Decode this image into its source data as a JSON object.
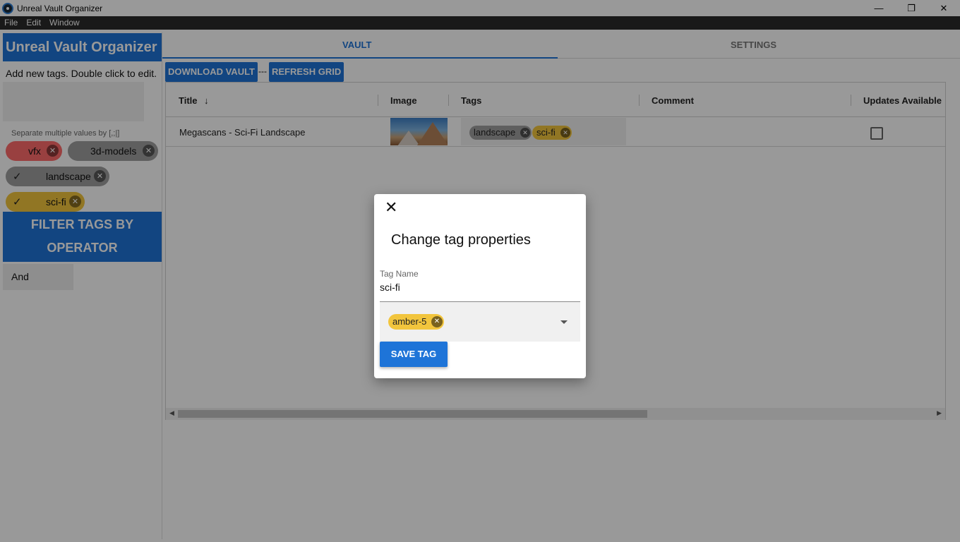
{
  "window": {
    "title": "Unreal Vault Organizer",
    "minimize": "—",
    "restore": "❐",
    "close": "✕"
  },
  "menu": [
    "File",
    "Edit",
    "Window"
  ],
  "sidebar": {
    "title": "Unreal Vault Organizer",
    "hint": "Add new tags. Double click to edit.",
    "separator_hint": "Separate multiple values by [,;|]",
    "tags": [
      {
        "label": "vfx",
        "color": "#ff6b6b",
        "selected": false
      },
      {
        "label": "3d-models",
        "color": "#9e9e9e",
        "selected": false
      },
      {
        "label": "landscape",
        "color": "#9e9e9e",
        "selected": true
      },
      {
        "label": "sci-fi",
        "color": "#f2c53d",
        "selected": true
      }
    ],
    "filter_button": "FILTER TAGS BY OPERATOR",
    "operator_value": "And"
  },
  "tabs": {
    "vault": "VAULT",
    "settings": "SETTINGS"
  },
  "toolbar": {
    "download": "DOWNLOAD VAULT",
    "separator": "---",
    "refresh": "REFRESH GRID"
  },
  "grid": {
    "columns": [
      "Title",
      "Image",
      "Tags",
      "Comment",
      "Updates Available"
    ],
    "rows": [
      {
        "title": "Megascans - Sci-Fi Landscape",
        "tags": [
          {
            "label": "landscape",
            "color": "#9e9e9e"
          },
          {
            "label": "sci-fi",
            "color": "#f2c53d"
          }
        ],
        "comment": "",
        "updates_available": false
      }
    ]
  },
  "dialog": {
    "title": "Change tag properties",
    "field_label": "Tag Name",
    "field_value": "sci-fi",
    "color_value": "amber-5",
    "save_button": "SAVE TAG"
  },
  "colors": {
    "primary": "#1e74d8",
    "menubar": "#2b2b2b",
    "amber": "#f2c53d",
    "red": "#ff6b6b",
    "grey": "#9e9e9e"
  }
}
